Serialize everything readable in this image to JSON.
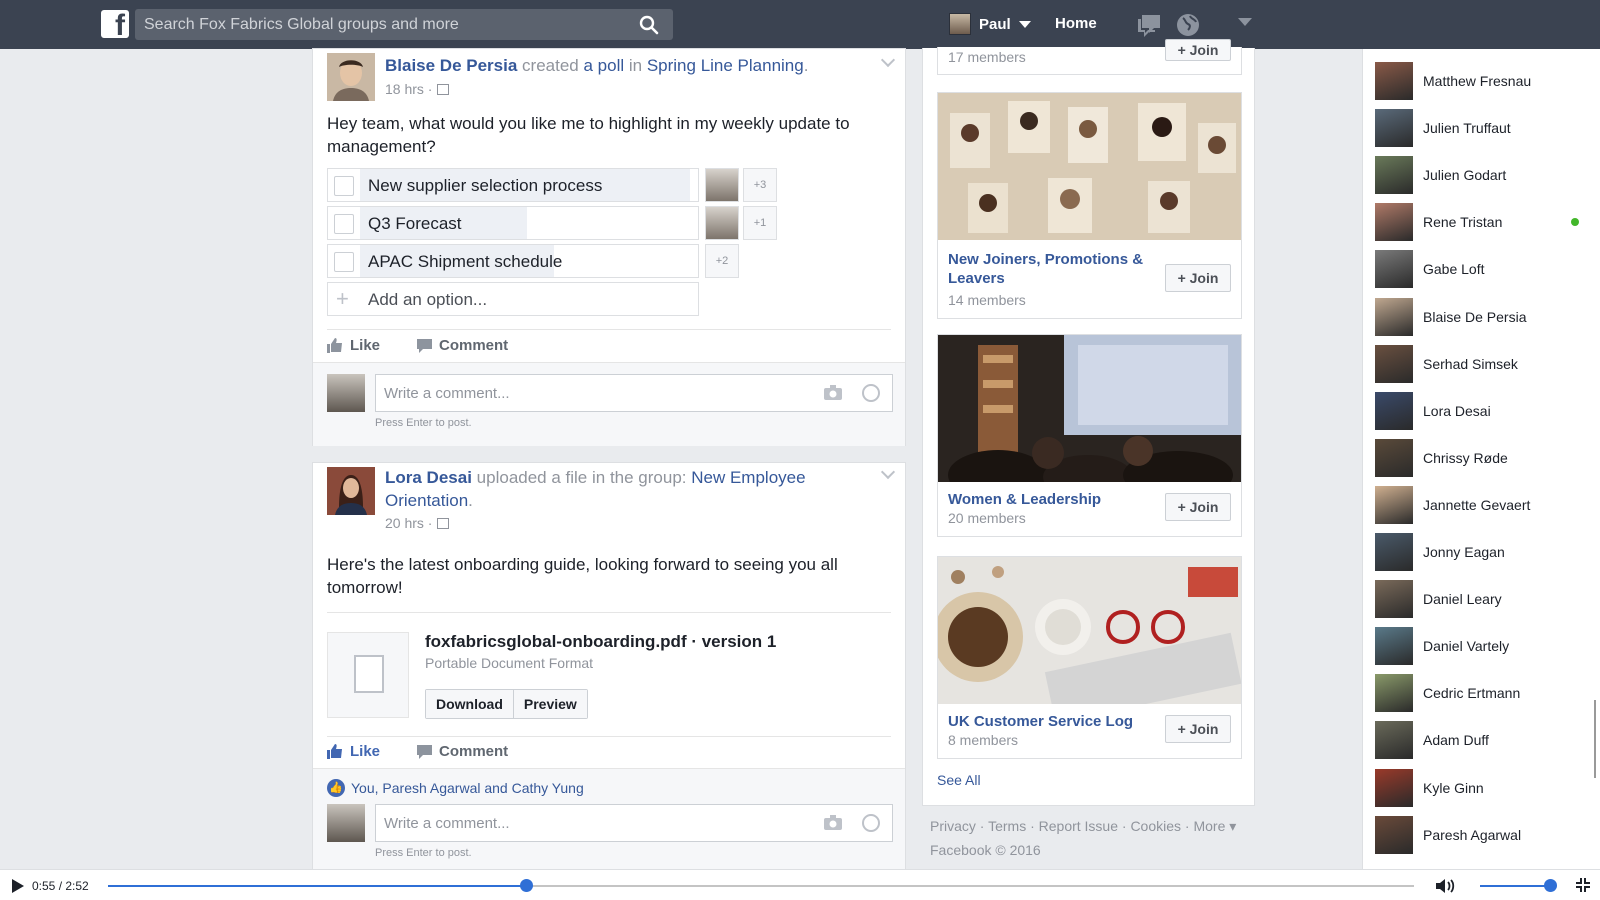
{
  "topbar": {
    "search_placeholder": "Search Fox Fabrics Global groups and more",
    "user_name": "Paul",
    "home_label": "Home"
  },
  "post1": {
    "author": "Blaise De Persia",
    "verb1": "created",
    "object": "a poll",
    "verb2": "in",
    "group": "Spring Line Planning",
    "period": ".",
    "time": "18 hrs ·",
    "text": "Hey team, what would you like me to highlight in my weekly update to management?",
    "poll": [
      {
        "label": "New supplier selection process",
        "more": "+3",
        "fill": 0.97
      },
      {
        "label": "Q3 Forecast",
        "more": "+1",
        "fill": 0.49
      },
      {
        "label": "APAC Shipment schedule",
        "more": "+2",
        "fill": 0.57
      }
    ],
    "add_option": "Add an option...",
    "like": "Like",
    "comment": "Comment",
    "comment_placeholder": "Write a comment...",
    "hint": "Press Enter to post."
  },
  "post2": {
    "author": "Lora Desai",
    "verb": "uploaded a file in the group:",
    "group_line1": "New Employee",
    "group_line2": "Orientation",
    "period": ".",
    "time": "20 hrs ·",
    "text": "Here's the latest onboarding guide, looking forward to seeing you all tomorrow!",
    "file_name": "foxfabricsglobal-onboarding.pdf · version 1",
    "file_type": "Portable Document Format",
    "download": "Download",
    "preview": "Preview",
    "like": "Like",
    "comment": "Comment",
    "likers": "You, Paresh Agarwal and Cathy Yung",
    "comment_placeholder": "Write a comment...",
    "hint": "Press Enter to post."
  },
  "groups": {
    "top_members": "17 members",
    "items": [
      {
        "name": "New Joiners, Promotions & Leavers",
        "members": "14 members",
        "join": "+ Join"
      },
      {
        "name": "Women & Leadership",
        "members": "20 members",
        "join": "+ Join"
      },
      {
        "name": "UK Customer Service Log",
        "members": "8 members",
        "join": "+ Join"
      }
    ],
    "see_all": "See All",
    "top_join": "+ Join"
  },
  "footer": {
    "links": "Privacy · Terms · Report Issue · Cookies · More ▾",
    "copyright": "Facebook © 2016"
  },
  "chat": {
    "friends": [
      {
        "name": "Matthew Fresnau",
        "online": false
      },
      {
        "name": "Julien Truffaut",
        "online": false
      },
      {
        "name": "Julien Godart",
        "online": false
      },
      {
        "name": "Rene Tristan",
        "online": true
      },
      {
        "name": "Gabe Loft",
        "online": false
      },
      {
        "name": "Blaise De Persia",
        "online": false
      },
      {
        "name": "Serhad Simsek",
        "online": false
      },
      {
        "name": "Lora Desai",
        "online": false
      },
      {
        "name": "Chrissy Røde",
        "online": false
      },
      {
        "name": "Jannette Gevaert",
        "online": false
      },
      {
        "name": "Jonny Eagan",
        "online": false
      },
      {
        "name": "Daniel Leary",
        "online": false
      },
      {
        "name": "Daniel Vartely",
        "online": false
      },
      {
        "name": "Cedric Ertmann",
        "online": false
      },
      {
        "name": "Adam Duff",
        "online": false
      },
      {
        "name": "Kyle Ginn",
        "online": false
      },
      {
        "name": "Paresh Agarwal",
        "online": false
      }
    ]
  },
  "video": {
    "time": "0:55 / 2:52",
    "progress": 0.32,
    "volume": 1.0
  },
  "colors": {
    "topbar": "#3b4351",
    "link": "#365899",
    "accent": "#4267b2",
    "online": "#42b72a",
    "progress": "#2f6fd6"
  }
}
